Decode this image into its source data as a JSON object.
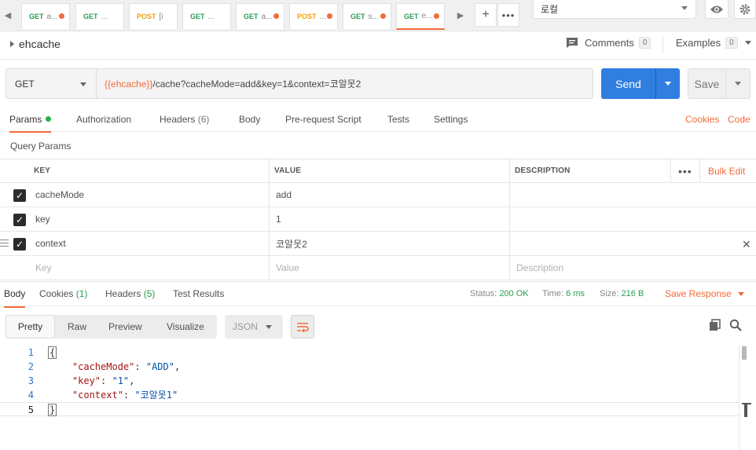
{
  "tabs": [
    {
      "method": "GET",
      "name": "a..."
    },
    {
      "method": "GET",
      "name": "..."
    },
    {
      "method": "POST",
      "name": "[i"
    },
    {
      "method": "GET",
      "name": "..."
    },
    {
      "method": "GET",
      "name": "a..."
    },
    {
      "method": "POST",
      "name": "..."
    },
    {
      "method": "GET",
      "name": "s..."
    },
    {
      "method": "GET",
      "name": "e..."
    }
  ],
  "environment": "로컬",
  "request": {
    "title": "ehcache",
    "comments_label": "Comments",
    "comments_count": "0",
    "examples_label": "Examples",
    "examples_count": "0",
    "method": "GET",
    "url_var": "{{ehcache}}",
    "url_rest": "/cache?cacheMode=add&key=1&context=코알못2",
    "send_label": "Send",
    "save_label": "Save"
  },
  "request_tabs": {
    "params": "Params",
    "authorization": "Authorization",
    "headers": "Headers",
    "headers_count": "(6)",
    "body": "Body",
    "prerequest": "Pre-request Script",
    "tests": "Tests",
    "settings": "Settings",
    "cookies": "Cookies",
    "code": "Code"
  },
  "query_params": {
    "title": "Query Params",
    "headers": {
      "key": "KEY",
      "value": "VALUE",
      "description": "DESCRIPTION",
      "bulk_edit": "Bulk Edit"
    },
    "rows": [
      {
        "key": "cacheMode",
        "value": "add"
      },
      {
        "key": "key",
        "value": "1"
      },
      {
        "key": "context",
        "value": "코알못2"
      }
    ],
    "placeholders": {
      "key": "Key",
      "value": "Value",
      "description": "Description"
    }
  },
  "response": {
    "tabs": {
      "body": "Body",
      "cookies": "Cookies",
      "cookies_count": "(1)",
      "headers": "Headers",
      "headers_count": "(5)",
      "test_results": "Test Results"
    },
    "status_label": "Status:",
    "status_value": "200 OK",
    "time_label": "Time:",
    "time_value": "6 ms",
    "size_label": "Size:",
    "size_value": "216 B",
    "save_response": "Save Response",
    "views": {
      "pretty": "Pretty",
      "raw": "Raw",
      "preview": "Preview",
      "visualize": "Visualize"
    },
    "format": "JSON",
    "lines": [
      {
        "num": "1",
        "text": "{"
      },
      {
        "num": "2",
        "key": "\"cacheMode\"",
        "sep": ": ",
        "val": "\"ADD\"",
        "end": ","
      },
      {
        "num": "3",
        "key": "\"key\"",
        "sep": ": ",
        "val": "\"1\"",
        "end": ","
      },
      {
        "num": "4",
        "key": "\"context\"",
        "sep": ": ",
        "val": "\"코알못1\"",
        "end": ""
      },
      {
        "num": "5",
        "text": "}"
      }
    ]
  },
  "colors": {
    "accent": "#f26b3a",
    "send_blue": "#2f7ee0",
    "get_green": "#2a9d4f",
    "post_orange": "#e8a317"
  }
}
